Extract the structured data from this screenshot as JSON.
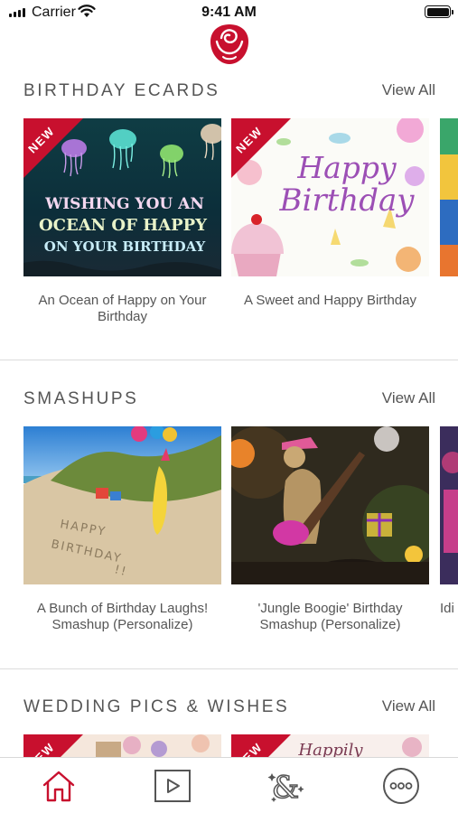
{
  "status_bar": {
    "carrier": "Carrier",
    "time": "9:41 AM"
  },
  "sections": [
    {
      "title": "BIRTHDAY ECARDS",
      "view_all": "View All",
      "cards": [
        {
          "badge": "NEW",
          "art_text": [
            "WISHING YOU AN",
            "OCEAN OF HAPPY",
            "ON YOUR BIRTHDAY"
          ],
          "caption": "An Ocean of Happy on Your Birthday"
        },
        {
          "badge": "NEW",
          "art_text": [
            "Happy",
            "Birthday"
          ],
          "caption": "A Sweet and Happy Birthday"
        }
      ]
    },
    {
      "title": "SMASHUPS",
      "view_all": "View All",
      "cards": [
        {
          "art_text": [
            "HAPPY",
            "BIRTHDAY",
            "!!"
          ],
          "caption": "A Bunch of Birthday Laughs! Smashup (Personalize)"
        },
        {
          "caption": "'Jungle Boogie' Birthday Smashup (Personalize)"
        }
      ],
      "peek_caption": "Idi"
    },
    {
      "title": "WEDDING PICS & WISHES",
      "view_all": "View All",
      "cards": [
        {
          "badge": "NEW"
        },
        {
          "badge": "NEW",
          "art_text": [
            "Happily"
          ]
        }
      ]
    }
  ],
  "tabbar": {
    "items": [
      {
        "icon": "home-icon",
        "active": true
      },
      {
        "icon": "video-play-icon",
        "active": false
      },
      {
        "icon": "ampersand-sparkle-icon",
        "active": false
      },
      {
        "icon": "more-ellipsis-icon",
        "active": false
      }
    ]
  },
  "colors": {
    "brand_red": "#c8102e",
    "text_gray": "#555555",
    "divider": "#dcdcdc"
  }
}
